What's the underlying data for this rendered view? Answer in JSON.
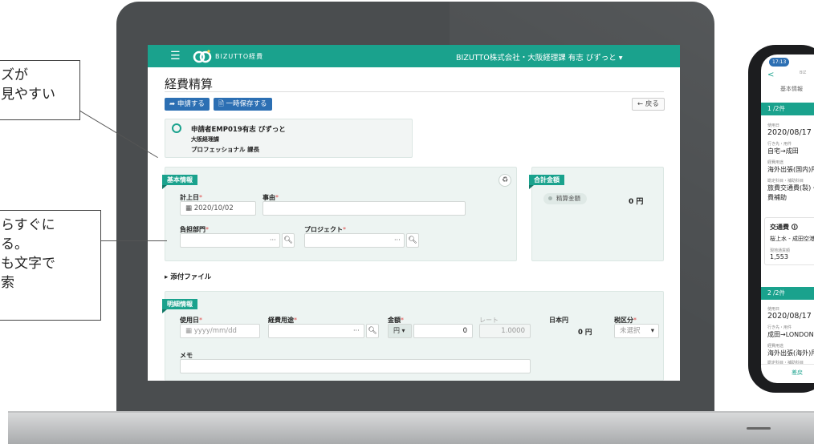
{
  "callouts": [
    {
      "lines": [
        "ズが",
        "見やすい"
      ]
    },
    {
      "lines": [
        "らすぐに",
        "る。",
        "も文字で",
        "索"
      ]
    }
  ],
  "app": {
    "menu_icon": "menu-icon",
    "logo_text": "BIZUTTO経費",
    "org_user": "BIZUTTO株式会社・大阪経理課 有志 びずっと ▾"
  },
  "page": {
    "title": "経費精算",
    "apply_button": "➦ 申請する",
    "save_button": "🗎 一時保存する",
    "back_button": "← 戻る"
  },
  "applicant": {
    "line1": "申請者EMP019有志 びずっと",
    "line2": "大阪経理課",
    "line3": "プロフェッショナル 課長"
  },
  "basic_info": {
    "tag": "基本情報",
    "post_date_label": "計上日",
    "post_date_value": "2020/10/02",
    "reason_label": "事由",
    "dept_label": "負担部門",
    "project_label": "プロジェクト",
    "required_mark": "*",
    "dots": "···"
  },
  "total": {
    "tag": "合計金額",
    "refund_label": "精算金額",
    "refund_value": "0 円"
  },
  "attachments": {
    "label": "▸ 添付ファイル"
  },
  "details": {
    "tag": "明細情報",
    "use_date_label": "使用日",
    "use_date_placeholder": "yyyy/mm/dd",
    "purpose_label": "経費用途",
    "amount_label": "金額",
    "currency": "円 ▾",
    "amount_value": "0",
    "rate_label": "レート",
    "rate_value": "1.0000",
    "jpy_label": "日本円",
    "jpy_value": "0 円",
    "tax_label": "税区分",
    "tax_value": "未選択",
    "tax_caret": "▾",
    "memo_label": "メモ"
  },
  "phone": {
    "time": "17:13",
    "back": "<",
    "brand": "BIZ",
    "tab": "基本情報",
    "group1": {
      "count": "1 /2件",
      "use_date_label": "使用日",
      "use_date": "2020/08/17",
      "route_label": "行き先・用件",
      "route": "自宅→成田",
      "purpose_label": "経費用途",
      "purpose": "海外出張(国内)用",
      "sub_label": "勘定科目・補助科目",
      "sub_value1": "旅費交通費(製)・旅",
      "sub_value2": "費補助"
    },
    "card": {
      "title": "交通費 🛈",
      "route": "桜上水 - 成田空港",
      "amount_label": "現地通貨額",
      "amount": "1,553"
    },
    "group2": {
      "count": "2 /2件",
      "use_date_label": "使用日",
      "use_date": "2020/08/17",
      "route_label": "行き先・用件",
      "route": "成田→LONDON",
      "purpose_label": "経費用途",
      "purpose": "海外出張(海外)用",
      "sub_label": "勘定科目・補助科目"
    },
    "return_label": "差戻"
  },
  "colors": {
    "brand": "#1aa28d",
    "button": "#2c6fb3",
    "laptop": "#4a4d4f"
  }
}
